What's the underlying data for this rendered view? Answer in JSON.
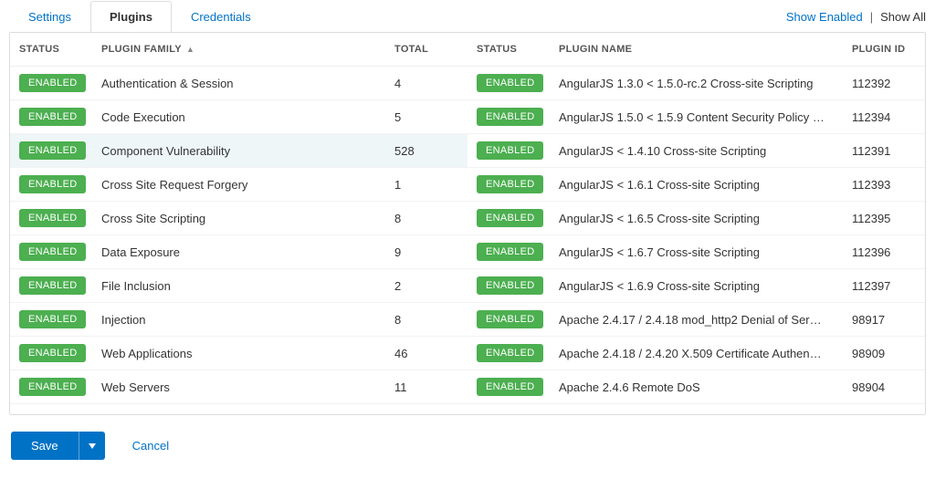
{
  "tabs": [
    {
      "label": "Settings",
      "active": false
    },
    {
      "label": "Plugins",
      "active": true
    },
    {
      "label": "Credentials",
      "active": false
    }
  ],
  "top_links": {
    "show_enabled": "Show Enabled",
    "separator": "|",
    "show_all": "Show All"
  },
  "left_table": {
    "headers": {
      "status": "STATUS",
      "family": "PLUGIN FAMILY",
      "total": "TOTAL"
    },
    "sort_indicator": "▲",
    "rows": [
      {
        "status": "ENABLED",
        "family": "Authentication & Session",
        "total": "4",
        "selected": false
      },
      {
        "status": "ENABLED",
        "family": "Code Execution",
        "total": "5",
        "selected": false
      },
      {
        "status": "ENABLED",
        "family": "Component Vulnerability",
        "total": "528",
        "selected": true
      },
      {
        "status": "ENABLED",
        "family": "Cross Site Request Forgery",
        "total": "1",
        "selected": false
      },
      {
        "status": "ENABLED",
        "family": "Cross Site Scripting",
        "total": "8",
        "selected": false
      },
      {
        "status": "ENABLED",
        "family": "Data Exposure",
        "total": "9",
        "selected": false
      },
      {
        "status": "ENABLED",
        "family": "File Inclusion",
        "total": "2",
        "selected": false
      },
      {
        "status": "ENABLED",
        "family": "Injection",
        "total": "8",
        "selected": false
      },
      {
        "status": "ENABLED",
        "family": "Web Applications",
        "total": "46",
        "selected": false
      },
      {
        "status": "ENABLED",
        "family": "Web Servers",
        "total": "11",
        "selected": false
      }
    ]
  },
  "right_table": {
    "headers": {
      "status": "STATUS",
      "name": "PLUGIN NAME",
      "id": "PLUGIN ID"
    },
    "rows": [
      {
        "status": "ENABLED",
        "name": "AngularJS 1.3.0 < 1.5.0-rc.2 Cross-site Scripting",
        "id": "112392"
      },
      {
        "status": "ENABLED",
        "name": "AngularJS 1.5.0 < 1.5.9 Content Security Policy …",
        "id": "112394"
      },
      {
        "status": "ENABLED",
        "name": "AngularJS < 1.4.10 Cross-site Scripting",
        "id": "112391"
      },
      {
        "status": "ENABLED",
        "name": "AngularJS < 1.6.1 Cross-site Scripting",
        "id": "112393"
      },
      {
        "status": "ENABLED",
        "name": "AngularJS < 1.6.5 Cross-site Scripting",
        "id": "112395"
      },
      {
        "status": "ENABLED",
        "name": "AngularJS < 1.6.7 Cross-site Scripting",
        "id": "112396"
      },
      {
        "status": "ENABLED",
        "name": "AngularJS < 1.6.9 Cross-site Scripting",
        "id": "112397"
      },
      {
        "status": "ENABLED",
        "name": "Apache 2.4.17 / 2.4.18 mod_http2 Denial of Ser…",
        "id": "98917"
      },
      {
        "status": "ENABLED",
        "name": "Apache 2.4.18 / 2.4.20 X.509 Certificate Authen…",
        "id": "98909"
      },
      {
        "status": "ENABLED",
        "name": "Apache 2.4.6 Remote DoS",
        "id": "98904"
      }
    ]
  },
  "footer": {
    "save": "Save",
    "cancel": "Cancel"
  }
}
